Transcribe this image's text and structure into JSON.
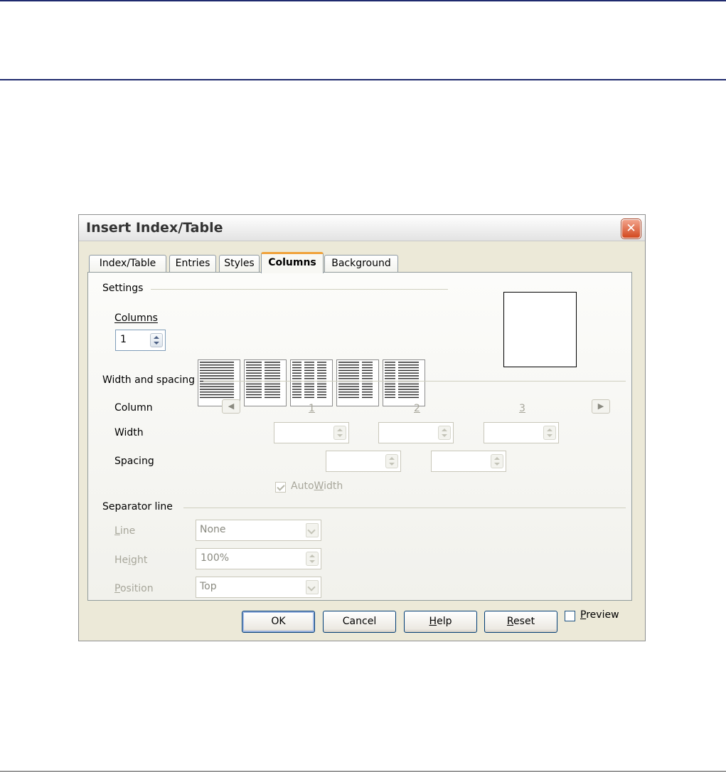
{
  "dialog": {
    "title": "Insert Index/Table",
    "close_glyph": "✕"
  },
  "tabs": [
    {
      "label": "Index/Table",
      "active": false
    },
    {
      "label": "Entries",
      "active": false
    },
    {
      "label": "Styles",
      "active": false
    },
    {
      "label": "Columns",
      "active": true
    },
    {
      "label": "Background",
      "active": false
    }
  ],
  "settings": {
    "group_label": "Settings",
    "columns_label": "Columns",
    "columns_value": "1",
    "presets": [
      {
        "name": "one-column",
        "columns": 1
      },
      {
        "name": "two-columns",
        "columns": 2
      },
      {
        "name": "three-columns",
        "columns": 3
      },
      {
        "name": "two-columns-left-large",
        "columns": 2
      },
      {
        "name": "two-columns-right-large",
        "columns": 2
      }
    ]
  },
  "width_spacing": {
    "group_label": "Width and spacing",
    "column_label": "Column",
    "width_label": "Width",
    "spacing_label": "Spacing",
    "column_numbers": [
      "1",
      "2",
      "3"
    ],
    "autowidth_label": "AutoWidth",
    "autowidth_checked": true
  },
  "separator": {
    "group_label": "Separator line",
    "line_label": "Line",
    "line_value": "None",
    "height_label": "Height",
    "height_value": "100%",
    "position_label": "Position",
    "position_value": "Top"
  },
  "buttons": {
    "ok": "OK",
    "cancel": "Cancel",
    "help": "Help",
    "reset": "Reset",
    "preview": "Preview"
  },
  "colors": {
    "rule": "#1f2a6e",
    "dialog_bg": "#ece9d8",
    "active_tab_accent": "#f0a23a",
    "close_button": "#d2481f"
  }
}
